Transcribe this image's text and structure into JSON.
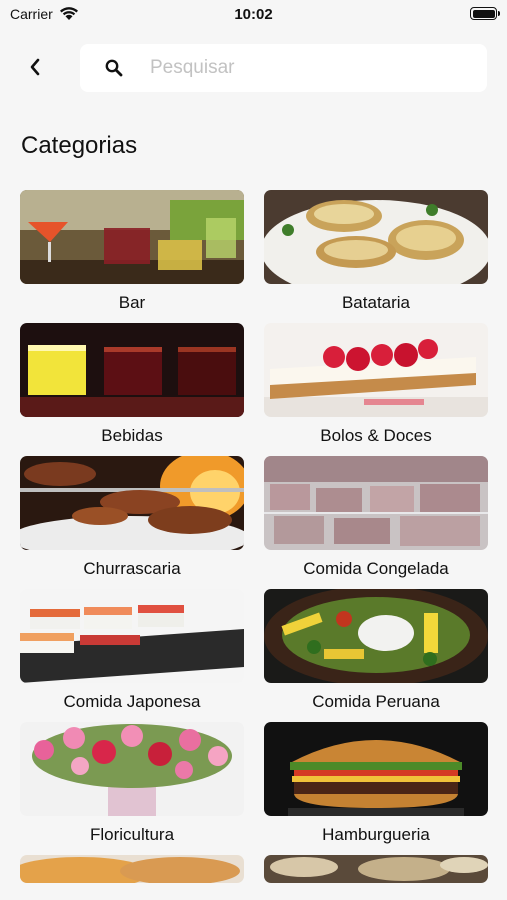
{
  "status_bar": {
    "carrier": "Carrier",
    "time": "10:02",
    "battery_level": 1.0
  },
  "header": {
    "back_icon": "chevron-left-icon",
    "search_icon": "search-icon",
    "search_placeholder": "Pesquisar",
    "search_value": ""
  },
  "section_title": "Categorias",
  "categories": [
    {
      "label": "Bar"
    },
    {
      "label": "Batataria"
    },
    {
      "label": "Bebidas"
    },
    {
      "label": "Bolos & Doces"
    },
    {
      "label": "Churrascaria"
    },
    {
      "label": "Comida Congelada"
    },
    {
      "label": "Comida Japonesa"
    },
    {
      "label": "Comida Peruana"
    },
    {
      "label": "Floricultura"
    },
    {
      "label": "Hamburgueria"
    }
  ],
  "colors": {
    "background": "#f6f6f6",
    "search_bg": "#ffffff",
    "placeholder": "#c2c2c2"
  }
}
